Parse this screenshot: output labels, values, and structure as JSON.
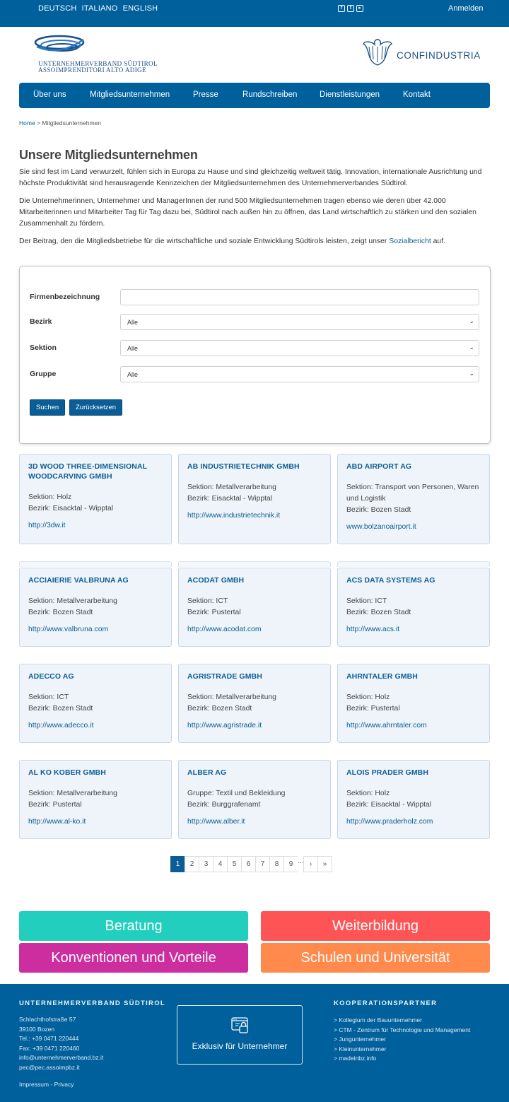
{
  "topbar": {
    "languages": [
      "DEUTSCH",
      "ITALIANO",
      "ENGLISH"
    ],
    "login": "Anmelden",
    "social_icons": [
      "facebook-icon",
      "twitter-icon",
      "youtube-icon"
    ]
  },
  "logo_left": {
    "line1": "UNTERNEHMERVERBAND SÜDTIROL",
    "line2": "ASSOIMPRENDITORI ALTO ADIGE"
  },
  "logo_right": {
    "text": "CONFINDUSTRIA"
  },
  "nav": {
    "items": [
      "Über uns",
      "Mitgliedsunternehmen",
      "Presse",
      "Rundschreiben",
      "Dienstleistungen",
      "Kontakt"
    ]
  },
  "breadcrumb": {
    "home": "Home",
    "sep": " > ",
    "current": "Mitgliedsunternehmen"
  },
  "intro": {
    "title": "Unsere Mitgliedsunternehmen",
    "p1": "Sie sind fest im Land verwurzelt, fühlen sich in Europa zu Hause und sind gleichzeitig weltweit tätig. Innovation, internationale Ausrichtung und höchste Produktivität sind herausragende Kennzeichen der Mitgliedsunternehmen des Unternehmerverbandes Südtirol.",
    "p2": "Die Unternehmerinnen, Unternehmer und ManagerInnen der rund 500 Mitgliedsunternehmen tragen ebenso wie deren über 42.000 Mitarbeiterinnen und Mitarbeiter Tag für Tag dazu bei, Südtirol nach außen hin zu öffnen, das Land wirtschaftlich zu stärken und den sozialen Zusammenhalt zu fördern.",
    "p3_before": "Der Beitrag, den die Mitgliedsbetriebe für die wirtschaftliche und soziale Entwicklung Südtirols leisten, zeigt unser ",
    "p3_link": "Sozialbericht",
    "p3_after": " auf."
  },
  "filter": {
    "company_label": "Firmenbezeichnung",
    "company_value": "",
    "district_label": "Bezirk",
    "district_value": "Alle",
    "section_label": "Sektion",
    "section_value": "Alle",
    "group_label": "Gruppe",
    "group_value": "Alle",
    "search_button": "Suchen",
    "reset_button": "Zurücksetzen"
  },
  "companies": [
    {
      "name": "3D WOOD THREE-DIMENSIONAL WOODCARVING GMBH",
      "line1": "Sektion: Holz",
      "line2": "Bezirk: Eisacktal - Wipptal",
      "url": "http://3dw.it"
    },
    {
      "name": "AB INDUSTRIETECHNIK GMBH",
      "line1": "Sektion: Metallverarbeitung",
      "line2": "Bezirk: Eisacktal - Wipptal",
      "url": "http://www.industrietechnik.it"
    },
    {
      "name": "ABD AIRPORT AG",
      "line1": "Sektion: Transport von Personen, Waren und Logistik",
      "line2": "Bezirk: Bozen Stadt",
      "url": "www.bolzanoairport.it"
    },
    {
      "name": "ACCIAIERIE VALBRUNA AG",
      "line1": "Sektion: Metallverarbeitung",
      "line2": "Bezirk: Bozen Stadt",
      "url": "http://www.valbruna.com"
    },
    {
      "name": "ACODAT GMBH",
      "line1": "Sektion: ICT",
      "line2": "Bezirk: Pustertal",
      "url": "http://www.acodat.com"
    },
    {
      "name": "ACS DATA SYSTEMS AG",
      "line1": "Sektion: ICT",
      "line2": "Bezirk: Bozen Stadt",
      "url": "http://www.acs.it"
    },
    {
      "name": "ADECCO AG",
      "line1": "Sektion: ICT",
      "line2": "Bezirk: Bozen Stadt",
      "url": "http://www.adecco.it"
    },
    {
      "name": "AGRISTRADE GMBH",
      "line1": "Sektion: Metallverarbeitung",
      "line2": "Bezirk: Bozen Stadt",
      "url": "http://www.agristrade.it"
    },
    {
      "name": "AHRNTALER GMBH",
      "line1": "Sektion: Holz",
      "line2": "Bezirk: Pustertal",
      "url": "http://www.ahrntaler.com"
    },
    {
      "name": "AL KO KOBER GMBH",
      "line1": "Sektion: Metallverarbeitung",
      "line2": "Bezirk: Pustertal",
      "url": "http://www.al-ko.it"
    },
    {
      "name": "ALBER AG",
      "line1": "Gruppe: Textil und Bekleidung",
      "line2": "Bezirk: Burggrafenamt",
      "url": "http://www.alber.it"
    },
    {
      "name": "ALOIS PRADER GMBH",
      "line1": "Sektion: Holz",
      "line2": "Bezirk: Eisacktal - Wipptal",
      "url": "http://www.praderholz.com"
    }
  ],
  "pagination": {
    "pages": [
      "1",
      "2",
      "3",
      "4",
      "5",
      "6",
      "7",
      "8",
      "9"
    ],
    "ellipsis": "...",
    "next": "›",
    "last": "»",
    "current": "1"
  },
  "tiles": [
    {
      "label": "Beratung",
      "color": "#22cfbf"
    },
    {
      "label": "Weiterbildung",
      "color": "#ff5455"
    },
    {
      "label": "Konventionen und Vorteile",
      "color": "#cc2d9f"
    },
    {
      "label": "Schulen und Universität",
      "color": "#ff8a4c"
    }
  ],
  "footer": {
    "org_title": "UNTERNEHMERVERBAND SÜDTIROL",
    "address": [
      "Schlachthofstraße 57",
      "39100 Bozen",
      "Tel.: +39 0471 220444",
      "Fax: +39 0471 220460",
      "info@unternehmerverband.bz.it",
      "pec@pec.assoimpbz.it"
    ],
    "impressum": "Impressum",
    "impressum_sep": " - ",
    "privacy": "Privacy",
    "exclusive": "Exklusiv für Unternehmer",
    "partners_title": "KOOPERATIONSPARTNER",
    "partners": [
      "> Kollegium der Bauunternehmer",
      "> CTM - Zentrum für Technologie und Management",
      "> Jungunternehmer",
      "> Kleinunternehmer",
      "> madeinbz.info"
    ]
  },
  "colors": {
    "brand_blue": "#00609c",
    "link_blue": "#0b5d95",
    "card_bg": "#eef4fa"
  }
}
